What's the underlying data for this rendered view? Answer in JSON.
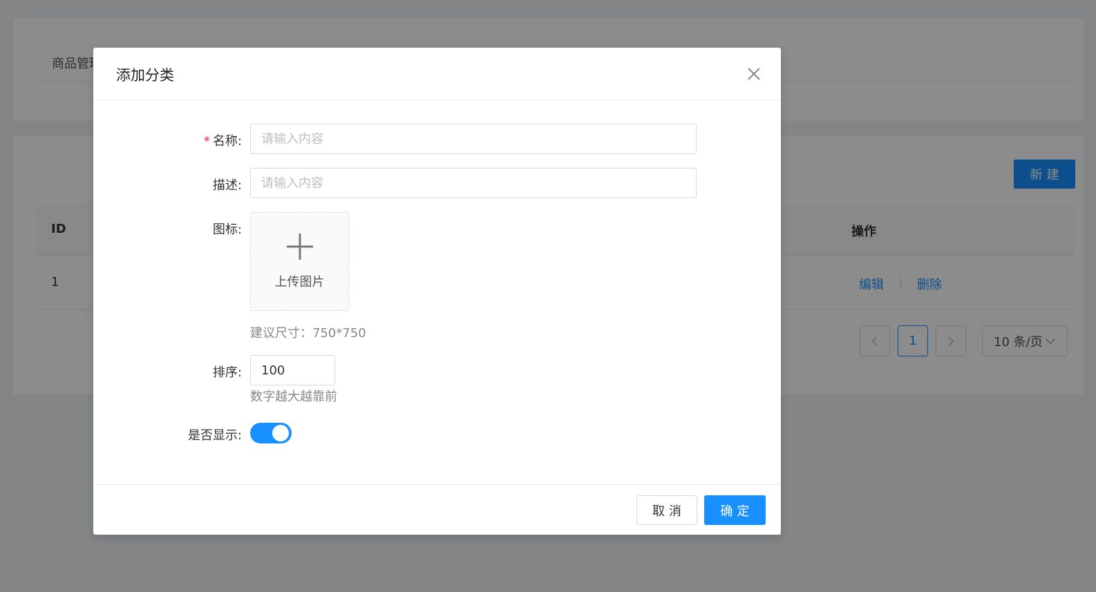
{
  "background": {
    "breadcrumb": "商品管理",
    "new_button": "新建",
    "table": {
      "headers": {
        "id": "ID",
        "actions": "操作"
      },
      "rows": [
        {
          "id": "1",
          "edit": "编辑",
          "delete": "删除"
        }
      ]
    },
    "pagination": {
      "prev": "<",
      "current": "1",
      "next": ">",
      "page_size": "10 条/页"
    }
  },
  "modal": {
    "title": "添加分类",
    "fields": {
      "name": {
        "label": "名称:",
        "placeholder": "请输入内容",
        "required": true
      },
      "description": {
        "label": "描述:",
        "placeholder": "请输入内容"
      },
      "icon": {
        "label": "图标:",
        "upload_text": "上传图片",
        "hint": "建议尺寸：750*750"
      },
      "sort": {
        "label": "排序:",
        "value": "100",
        "hint": "数字越大越靠前"
      },
      "visible": {
        "label": "是否显示:",
        "on": true
      }
    },
    "footer": {
      "cancel": "取消",
      "ok": "确定"
    }
  },
  "colors": {
    "primary": "#1890ff",
    "required": "#f5222d"
  }
}
